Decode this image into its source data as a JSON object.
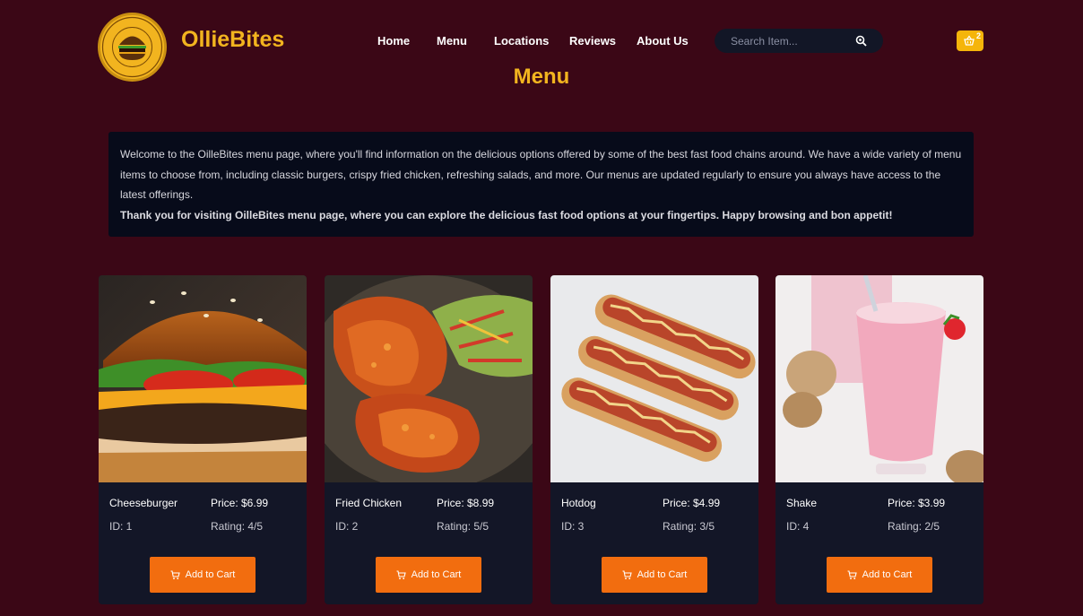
{
  "brand": {
    "name": "OllieBites",
    "logo_text": "OLLIEBITES",
    "logo_tagline": "YOUR CRAVINGS, OUR BITES"
  },
  "nav": {
    "items": [
      "Home",
      "Menu",
      "Locations",
      "Reviews",
      "About Us"
    ]
  },
  "search": {
    "placeholder": "Search Item..."
  },
  "cart": {
    "count": "2"
  },
  "page": {
    "title": "Menu"
  },
  "intro": {
    "text": "Welcome to the OilleBites menu page, where you'll find information on the delicious options offered by some of the best fast food chains around. We have a wide variety of menu items to choose from, including classic burgers, crispy fried chicken, refreshing salads, and more. Our menus are updated regularly to ensure you always have access to the latest offerings.",
    "bold": "Thank you for visiting OilleBites menu page, where you can explore the delicious fast food options at your fingertips. Happy browsing and bon appetit!"
  },
  "products": [
    {
      "name": "Cheeseburger",
      "price": "Price: $6.99",
      "id": "ID: 1",
      "rating": "Rating: 4/5",
      "button": "Add to Cart"
    },
    {
      "name": "Fried Chicken",
      "price": "Price: $8.99",
      "id": "ID: 2",
      "rating": "Rating: 5/5",
      "button": "Add to Cart"
    },
    {
      "name": "Hotdog",
      "price": "Price: $4.99",
      "id": "ID: 3",
      "rating": "Rating: 3/5",
      "button": "Add to Cart"
    },
    {
      "name": "Shake",
      "price": "Price: $3.99",
      "id": "ID: 4",
      "rating": "Rating: 2/5",
      "button": "Add to Cart"
    }
  ],
  "colors": {
    "background": "#3b0716",
    "accent": "#f2b41f",
    "button": "#f26d0f",
    "card": "#131627"
  },
  "icons": {
    "search": "search-icon",
    "cart": "basket-icon",
    "add_to_cart": "cart-icon"
  }
}
